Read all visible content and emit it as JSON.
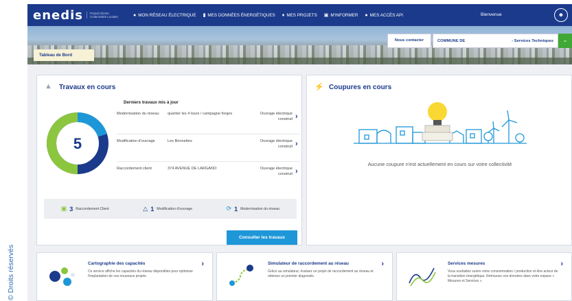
{
  "copyright": "© Droits réservés",
  "header": {
    "logo": "enedis",
    "logo_subtitle": "Portail Clients Collectivités Locales",
    "nav": [
      {
        "label": "MON RÉSEAU ÉLECTRIQUE",
        "icon": "location-pin-icon"
      },
      {
        "label": "MES DONNÉES ÉNERGÉTIQUES",
        "icon": "bar-chart-icon"
      },
      {
        "label": "MES PROJETS",
        "icon": "lightbulb-icon"
      },
      {
        "label": "M'INFORMER",
        "icon": "news-icon"
      },
      {
        "label": "MES ACCÈS API",
        "icon": "location-pin-icon"
      }
    ],
    "welcome": "Bienvenue",
    "user_icon": "user-icon"
  },
  "toolbar": {
    "contact_label": "Nous contacter",
    "commune_label": "COMMUNE DE",
    "commune_service": "- Services Techniques",
    "dashboard_tab": "Tableau de Bord"
  },
  "travaux": {
    "title": "Travaux en cours",
    "total": "5",
    "list_title": "Derniers travaux mis à jour",
    "rows": [
      {
        "type": "Modernisation du réseau",
        "location": "quartier les 4 tours / campagne forges",
        "status": "Ouvrage électrique construit"
      },
      {
        "type": "Modification d'ouvrage",
        "location": "Les Bonnettes",
        "status": "Ouvrage électrique construit"
      },
      {
        "type": "Raccordement client",
        "location": "374 AVENUE DE LARGANO",
        "status": "Ouvrage électrique construit"
      }
    ],
    "stats": [
      {
        "count": "3",
        "label": "Raccordement Client",
        "color": "#8cc63f"
      },
      {
        "count": "1",
        "label": "Modification d'ouvrage",
        "color": "#1b3a8b"
      },
      {
        "count": "1",
        "label": "Modernisation du réseau",
        "color": "#1e97d8"
      }
    ],
    "donut_colors": [
      "#8cc63f",
      "#1b3a8b",
      "#1e97d8"
    ],
    "consult_button": "Consulter les travaux"
  },
  "coupures": {
    "title": "Coupures en cours",
    "empty_message": "Aucune coupure n'est actuellement en cours sur votre collectivité"
  },
  "services": [
    {
      "title": "Cartographie des capacités",
      "description": "Ce service affiche les capacités du réseau disponibles pour optimiser l'implantation de vos nouveaux projets."
    },
    {
      "title": "Simulateur de raccordement au réseau",
      "description": "Grâce au simulateur, évaluez un projet de raccordement au réseau et obtenez un premier diagnostic."
    },
    {
      "title": "Services mesures",
      "description": "Vous souhaitez suivre votre consommation / production et être acteur de la transition énergétique. Retrouvez vos données dans votre espace « Mesures et Services »."
    }
  ]
}
